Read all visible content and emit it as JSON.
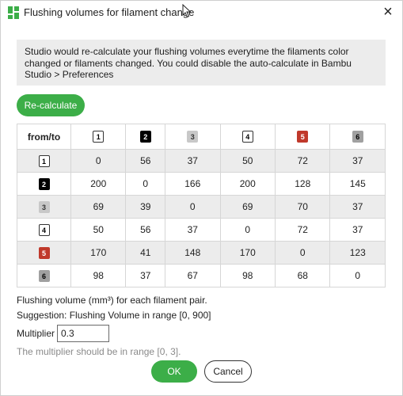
{
  "window": {
    "title": "Flushing volumes for filament change"
  },
  "info_text": "Studio would re-calculate your flushing volumes everytime the filaments color changed or filaments changed. You could disable the auto-calculate in Bambu Studio > Preferences",
  "recalc_label": "Re-calculate",
  "table": {
    "corner_label": "from/to",
    "filaments": [
      {
        "label": "1",
        "bg": "#ffffff",
        "fg": "#000000"
      },
      {
        "label": "2",
        "bg": "#000000",
        "fg": "#ffffff"
      },
      {
        "label": "3",
        "bg": "#c8c8c8",
        "fg": "#333333"
      },
      {
        "label": "4",
        "bg": "#ffffff",
        "fg": "#000000"
      },
      {
        "label": "5",
        "bg": "#c0392b",
        "fg": "#ffffff"
      },
      {
        "label": "6",
        "bg": "#a0a0a0",
        "fg": "#000000"
      }
    ],
    "rows": [
      [
        "0",
        "56",
        "37",
        "50",
        "72",
        "37"
      ],
      [
        "200",
        "0",
        "166",
        "200",
        "128",
        "145"
      ],
      [
        "69",
        "39",
        "0",
        "69",
        "70",
        "37"
      ],
      [
        "50",
        "56",
        "37",
        "0",
        "72",
        "37"
      ],
      [
        "170",
        "41",
        "148",
        "170",
        "0",
        "123"
      ],
      [
        "98",
        "37",
        "67",
        "98",
        "68",
        "0"
      ]
    ]
  },
  "volume_note": "Flushing volume (mm³) for each filament pair.",
  "suggestion": "Suggestion: Flushing Volume in range [0, 900]",
  "multiplier": {
    "label": "Multiplier",
    "value": "0.3"
  },
  "multiplier_hint": "The multiplier should be in range [0, 3].",
  "buttons": {
    "ok": "OK",
    "cancel": "Cancel"
  },
  "colors": {
    "accent": "#3cae48",
    "shade": "#ececec"
  }
}
